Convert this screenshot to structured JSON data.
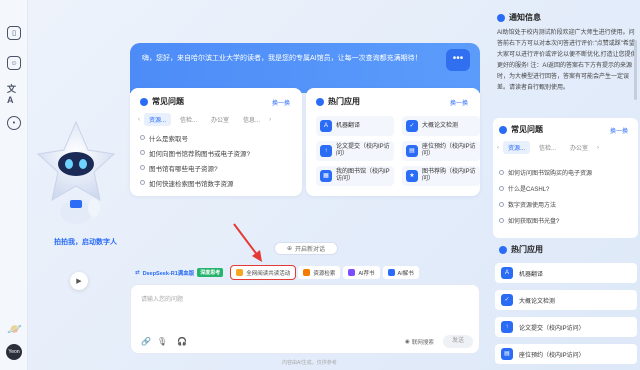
{
  "rail": {
    "icons": [
      "sidebar-toggle-icon",
      "new-chat-icon",
      "translate-icon",
      "discover-icon"
    ],
    "avatar_text": "Yeon"
  },
  "mascot": {
    "label": "拍拍我，启动数字人"
  },
  "welcome": {
    "message": "嗨，您好，来自哈尔滨工业大学的读者，我是您的专属AI馆员，让每一次查询都充满期待！"
  },
  "faq": {
    "title": "常见问题",
    "swap_label": "换一换",
    "tabs": [
      "资源...",
      "信检...",
      "办公室",
      "信息..."
    ],
    "items": [
      "什么是索取号",
      "如何向图书馆荐购图书或电子资源?",
      "图书馆有哪些电子资源?",
      "如何快速检索图书馆数字资源"
    ]
  },
  "hot_apps": {
    "title": "热门应用",
    "swap_label": "换一换",
    "apps": [
      {
        "label": "机器翻译"
      },
      {
        "label": "大概论文检测"
      },
      {
        "label": "论文提交（校内IP访问）"
      },
      {
        "label": "座位预约（校内IP访问）"
      },
      {
        "label": "我的图书馆（校内IP访问）"
      },
      {
        "label": "图书荐购（校内IP访问）"
      }
    ]
  },
  "new_chat_label": "开启新对话",
  "chips": {
    "model_label": "DeepSeek-R1满血版",
    "model_badge": "深度思考",
    "items": [
      "全网阅读共读活动",
      "资源检索",
      "AI荐书",
      "AI解书"
    ]
  },
  "input": {
    "placeholder": "请输入您的问题",
    "net_search_label": "联网搜索",
    "send_label": "发送"
  },
  "footer_note": "内容由AI生成，仅供参考",
  "notice": {
    "title": "通知信息",
    "body": "AI助馆处于校内测试阶段欢迎广大师生进行使用。问答前右下方可以对本次问答进行评价:\"点赞或踩\"希望大家可以进行评价或评论以便不断优化,打造让您提供更好的服务! 注：AI返回的答案右下方有提示的来源时，为大模型进行回答，答案有可能会产生一定误差。请读者自行甄别使用。"
  },
  "right_faq": {
    "title": "常见问题",
    "swap_label": "换一换",
    "tabs": [
      "资源...",
      "信检...",
      "办公室"
    ],
    "items": [
      "如何访问图书馆购买的电子资源",
      "什么是CASHL?",
      "数字资源使用方法",
      "如何获取图书光盘?"
    ]
  },
  "right_apps": {
    "title": "热门应用",
    "apps": [
      "机器翻译",
      "大概论文检测",
      "论文提交（校内IP访问）",
      "座位预约（校内IP访问）"
    ]
  },
  "colors": {
    "accent": "#2b6cf6",
    "highlight": "#e53935",
    "badge": "#26b36b"
  }
}
